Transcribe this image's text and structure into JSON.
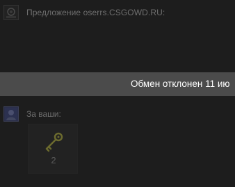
{
  "offer": {
    "title": "Предложение oserrs.CSGOWD.RU:",
    "avatar_icon": "user-avatar-icon"
  },
  "status": {
    "text": "Обмен отклонен 11 ию"
  },
  "yours": {
    "label": "За ваши:",
    "avatar_icon": "user-avatar-icon",
    "items": [
      {
        "icon": "key-icon",
        "count": "2"
      }
    ]
  },
  "colors": {
    "background": "#1d1d1d",
    "status_bar": "#4b4b4b",
    "key": "#6b6a2e"
  }
}
